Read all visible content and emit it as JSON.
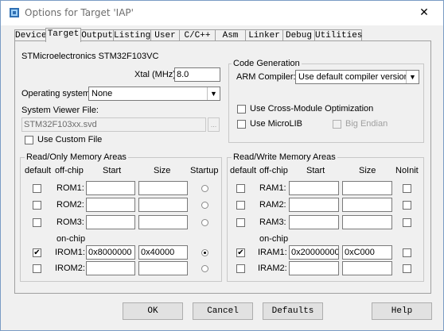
{
  "window": {
    "title": "Options for Target 'IAP'"
  },
  "tabs": [
    "Device",
    "Target",
    "Output",
    "Listing",
    "User",
    "C/C++",
    "Asm",
    "Linker",
    "Debug",
    "Utilities"
  ],
  "device": {
    "name": "STMicroelectronics STM32F103VC"
  },
  "xtal": {
    "label": "Xtal (MHz):",
    "value": "8.0"
  },
  "os": {
    "label": "Operating system:",
    "value": "None"
  },
  "svd": {
    "label": "System Viewer File:",
    "value": "STM32F103xx.svd",
    "browse": "..."
  },
  "custom_file": {
    "label": "Use Custom File"
  },
  "codegen": {
    "title": "Code Generation",
    "compiler_label": "ARM Compiler:",
    "compiler_value": "Use default compiler version",
    "cross_module": "Use Cross-Module Optimization",
    "microlib": "Use MicroLIB",
    "big_endian": "Big Endian"
  },
  "ro": {
    "title": "Read/Only Memory Areas",
    "headers": {
      "default": "default",
      "offchip": "off-chip",
      "start": "Start",
      "size": "Size",
      "startup": "Startup"
    },
    "onchip": "on-chip",
    "rows": [
      {
        "name": "ROM1:",
        "start": "",
        "size": ""
      },
      {
        "name": "ROM2:",
        "start": "",
        "size": ""
      },
      {
        "name": "ROM3:",
        "start": "",
        "size": ""
      },
      {
        "name": "IROM1:",
        "start": "0x8000000",
        "size": "0x40000"
      },
      {
        "name": "IROM2:",
        "start": "",
        "size": ""
      }
    ]
  },
  "rw": {
    "title": "Read/Write Memory Areas",
    "headers": {
      "default": "default",
      "offchip": "off-chip",
      "start": "Start",
      "size": "Size",
      "noinit": "NoInit"
    },
    "onchip": "on-chip",
    "rows": [
      {
        "name": "RAM1:",
        "start": "",
        "size": ""
      },
      {
        "name": "RAM2:",
        "start": "",
        "size": ""
      },
      {
        "name": "RAM3:",
        "start": "",
        "size": ""
      },
      {
        "name": "IRAM1:",
        "start": "0x20000000",
        "size": "0xC000"
      },
      {
        "name": "IRAM2:",
        "start": "",
        "size": ""
      }
    ]
  },
  "buttons": {
    "ok": "OK",
    "cancel": "Cancel",
    "defaults": "Defaults",
    "help": "Help"
  },
  "glyphs": {
    "check": "✔",
    "dropdown": "▼",
    "close": "✕"
  }
}
